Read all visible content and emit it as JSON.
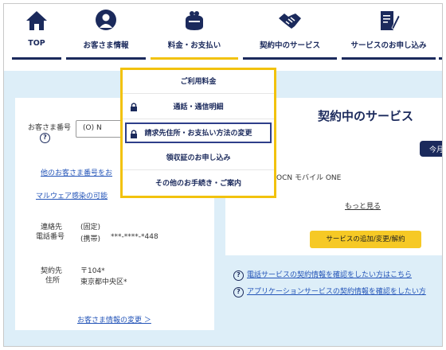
{
  "nav": [
    {
      "label": "TOP",
      "icon": "home-icon"
    },
    {
      "label": "お客さま情報",
      "icon": "person-icon"
    },
    {
      "label": "料金・お支払い",
      "icon": "wallet-icon"
    },
    {
      "label": "契約中のサービス",
      "icon": "handshake-icon"
    },
    {
      "label": "サービスのお申し込み",
      "icon": "form-pen-icon"
    }
  ],
  "dropdown": {
    "items": [
      {
        "label": "ご利用料金",
        "locked": false
      },
      {
        "label": "通話・通信明細",
        "locked": true
      },
      {
        "label": "請求先住所・お支払い方法の変更",
        "locked": true
      },
      {
        "label": "領収証のお申し込み",
        "locked": false
      },
      {
        "label": "その他のお手続き・ご案内",
        "locked": false
      }
    ]
  },
  "customer": {
    "number_label": "お客さま番号",
    "number_value": "(O) N",
    "other_number_link": "他のお客さま番号をお",
    "malware_link": "マルウェア感染の可能",
    "contact_label_1": "連絡先",
    "contact_label_2": "電話番号",
    "fixed_label": "(固定)",
    "mobile_label": "(携帯)",
    "mobile_value": "***-****-*448",
    "address_label_1": "契約先",
    "address_label_2": "住所",
    "postal": "〒104*",
    "address": "東京都中央区*",
    "change_link": "お客さま情報の変更 ＞"
  },
  "services": {
    "title": "契約中のサービス",
    "month_tab": "今月",
    "service_name": "OCN モバイル ONE",
    "more_link": "もっと見る",
    "add_button": "サービスの追加/変更/解約",
    "info_links": [
      "電話サービスの契約情報を確認をしたい方はこちら",
      "アプリケーションサービスの契約情報を確認をしたい方"
    ]
  },
  "colors": {
    "navy": "#1b2a5c",
    "accent_yellow": "#f2c20d",
    "page_bg": "#ddeef8",
    "link_blue": "#2354b8"
  }
}
